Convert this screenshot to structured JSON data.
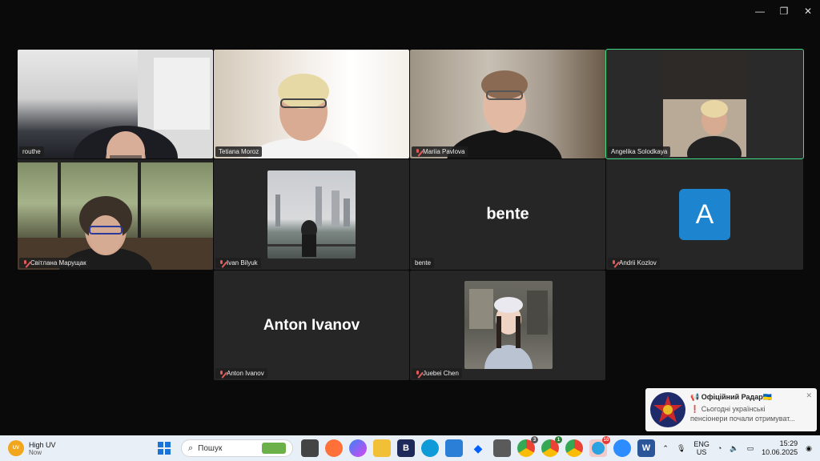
{
  "window_controls": {
    "minimize": "—",
    "maximize": "❐",
    "close": "✕"
  },
  "participants": [
    {
      "name": "routhe",
      "muted": false
    },
    {
      "name": "Tetiana Moroz",
      "muted": false
    },
    {
      "name": "Mariia Pavlova",
      "muted": true
    },
    {
      "name": "Angelika Solodkaya",
      "muted": false
    },
    {
      "name": "Світлана Марущак",
      "muted": true
    },
    {
      "name": "Ivan Bilyuk",
      "muted": true
    },
    {
      "name": "bente",
      "muted": false,
      "display_text": "bente"
    },
    {
      "name": "Andrii Kozlov",
      "muted": true,
      "avatar_letter": "A"
    },
    {
      "name": "Anton Ivanov",
      "muted": true,
      "display_text": "Anton Ivanov"
    },
    {
      "name": "Juebei Chen",
      "muted": true
    }
  ],
  "notification": {
    "title": "📢 Офіційний Радар🇺🇦",
    "body": "❗ Сьогодні українські пенсіонери почали отримуват..."
  },
  "taskbar": {
    "weather": {
      "badge": "UV",
      "title": "High UV",
      "subtitle": "Now"
    },
    "search_placeholder": "Пошук",
    "badges": {
      "chrome1": "3",
      "chrome2": "1",
      "telegram": "10"
    },
    "lang": {
      "line1": "ENG",
      "line2": "US"
    },
    "time": "15:29",
    "date": "10.06.2025"
  },
  "colors": {
    "active_border": "#3ddc84",
    "avatar_bg": "#1d84d0",
    "tile_bg": "#262626"
  }
}
